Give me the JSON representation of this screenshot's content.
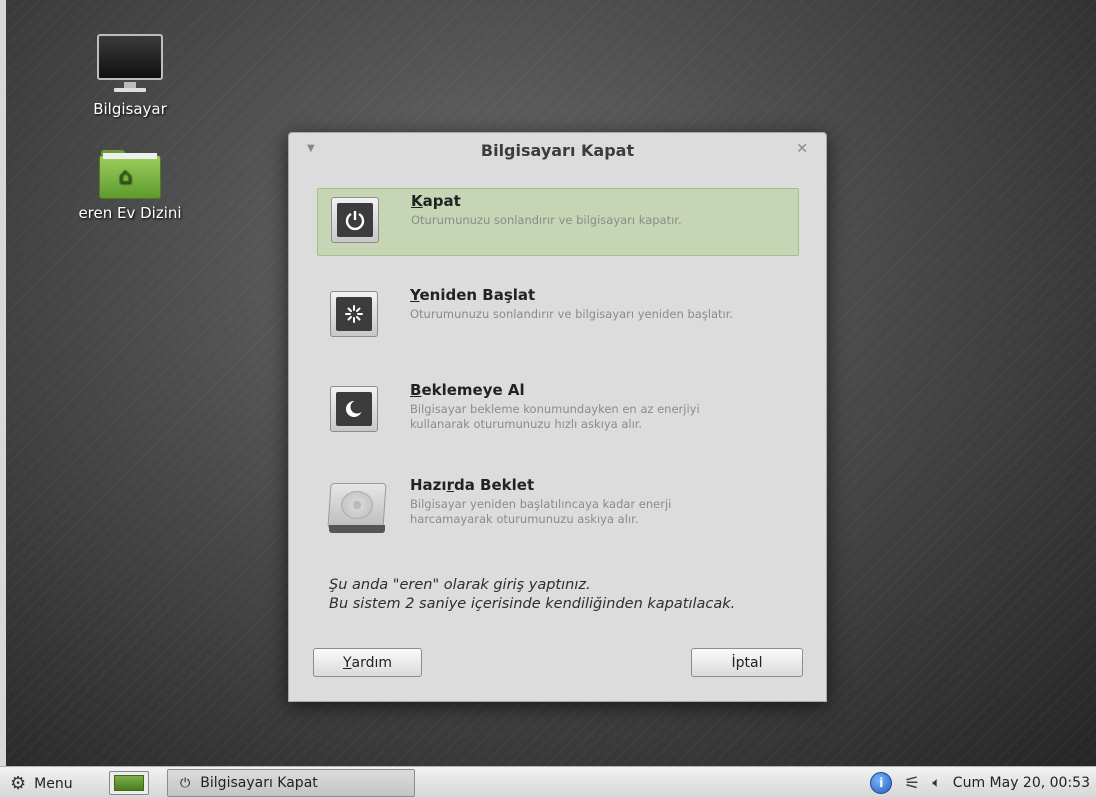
{
  "desktop": {
    "icons": [
      {
        "label": "Bilgisayar",
        "icon": "computer-icon"
      },
      {
        "label": "eren Ev Dizini",
        "icon": "home-folder-icon"
      }
    ]
  },
  "dialog": {
    "title": "Bilgisayarı Kapat",
    "options": [
      {
        "title_prefix": "",
        "title_mnemonic": "K",
        "title_rest": "apat",
        "description": "Oturumunuzu sonlandırır ve bilgisayarı kapatır.",
        "icon": "power-icon",
        "selected": true
      },
      {
        "title_prefix": "",
        "title_mnemonic": "Y",
        "title_rest": "eniden Başlat",
        "description": "Oturumunuzu sonlandırır ve bilgisayarı yeniden başlatır.",
        "icon": "restart-icon",
        "selected": false
      },
      {
        "title_prefix": "",
        "title_mnemonic": "B",
        "title_rest": "eklemeye Al",
        "description": "Bilgisayar bekleme konumundayken en az enerjiyi kullanarak oturumunuzu hızlı askıya alır.",
        "icon": "moon-icon",
        "selected": false
      },
      {
        "title_prefix": "Hazı",
        "title_mnemonic": "r",
        "title_rest": "da Beklet",
        "description": "Bilgisayar yeniden başlatılıncaya kadar enerji harcamayarak oturumunuzu askıya alır.",
        "icon": "hard-disk-icon",
        "selected": false
      }
    ],
    "status_line1": "Şu anda \"eren\" olarak giriş yaptınız.",
    "status_line2": "Bu sistem 2 saniye içerisinde kendiliğinden kapatılacak.",
    "help_mnemonic": "Y",
    "help_rest": "ardım",
    "cancel_label": "İptal"
  },
  "taskbar": {
    "menu_label": "Menu",
    "window_label": "Bilgisayarı Kapat",
    "clock": "Cum May 20, 00:53"
  },
  "colors": {
    "selected_bg": "#c6d6b4",
    "dialog_bg": "#dcdcdc",
    "folder_green": "#7fb84a"
  }
}
